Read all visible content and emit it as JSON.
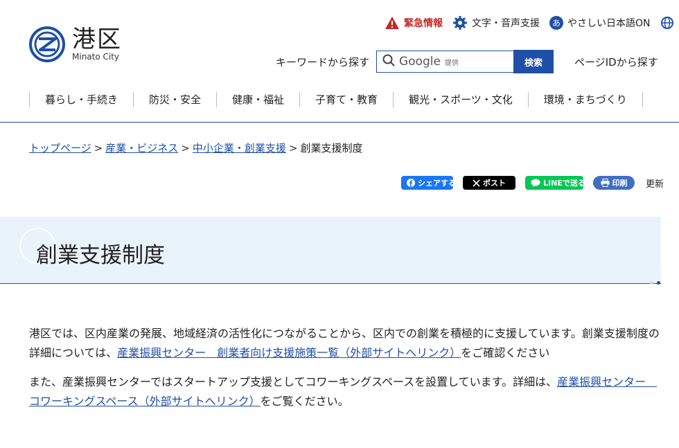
{
  "header": {
    "logo_kanji": "港区",
    "logo_en": "Minato City",
    "util": {
      "emergency": "緊急情報",
      "text_voice": "文字・音声支援",
      "easy_japanese": "やさしい日本語ON"
    },
    "search": {
      "label": "キーワードから探す",
      "google_word": "Google",
      "provided": "提供",
      "button": "検索"
    },
    "pageid_label": "ページIDから探す"
  },
  "nav": {
    "items": [
      "暮らし・手続き",
      "防災・安全",
      "健康・福祉",
      "子育て・教育",
      "観光・スポーツ・文化",
      "環境・まちづくり"
    ]
  },
  "breadcrumb": {
    "top": "トップページ",
    "industry": "産業・ビジネス",
    "sme": "中小企業・創業支援",
    "current": "創業支援制度",
    "separator": ">"
  },
  "share": {
    "facebook": "シェアする",
    "x": "ポスト",
    "line": "LINEで送る",
    "print": "印刷",
    "updated": "更新"
  },
  "page": {
    "title": "創業支援制度",
    "p1_text1": "港区では、区内産業の発展、地域経済の活性化につながることから、区内での創業を積極的に支援しています。創業支援制度の詳細については、",
    "p1_link": "産業振興センター　創業者向け支援施策一覧（外部サイトへリンク）",
    "p1_text2": "をご確認ください",
    "p2_text1": "また、産業振興センターではスタートアップ支援としてコワーキングスペースを設置しています。詳細は、",
    "p2_link": "産業振興センター　コワーキングスペース（外部サイトへリンク）",
    "p2_text2": "をご覧ください。"
  },
  "colors": {
    "brand_blue": "#1f4fa8",
    "emergency_red": "#c62828",
    "band_bg": "#e9f3fb"
  }
}
